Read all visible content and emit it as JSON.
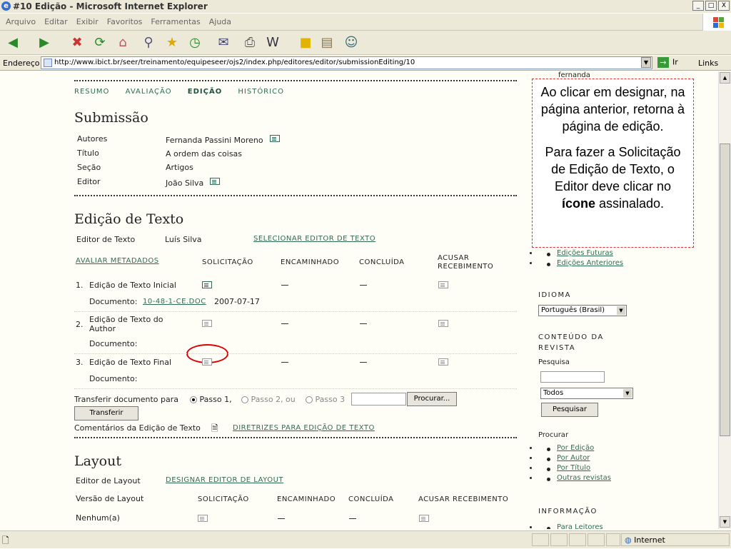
{
  "window": {
    "title": "#10 Edição - Microsoft Internet Explorer",
    "controls": [
      "_",
      "□",
      "X"
    ]
  },
  "menu": [
    "Arquivo",
    "Editar",
    "Exibir",
    "Favoritos",
    "Ferramentas",
    "Ajuda"
  ],
  "address": {
    "label": "Endereço",
    "url": "http://www.ibict.br/seer/treinamento/equipeseer/ojs2/index.php/editores/editor/submissionEditing/10",
    "go": "Ir",
    "links": "Links"
  },
  "status": {
    "zone": "Internet"
  },
  "tabs": [
    "RESUMO",
    "AVALIAÇÃO",
    "EDIÇÃO",
    "HISTÓRICO"
  ],
  "submission": {
    "heading": "Submissão",
    "rows": [
      {
        "label": "Autores",
        "value": "Fernanda Passini Moreno"
      },
      {
        "label": "Título",
        "value": "A ordem das coisas"
      },
      {
        "label": "Seção",
        "value": "Artigos"
      },
      {
        "label": "Editor",
        "value": "João Silva"
      }
    ]
  },
  "copyedit": {
    "heading": "Edição de Texto",
    "editor_label": "Editor de Texto",
    "editor_name": "Luís Silva",
    "select_link": "SELECIONAR EDITOR DE TEXTO",
    "metadata_link": "AVALIAR METADADOS",
    "columns": [
      "SOLICITAÇÃO",
      "ENCAMINHADO",
      "CONCLUÍDA",
      "ACUSAR RECEBIMENTO"
    ],
    "steps": [
      {
        "num": "1.",
        "name": "Edição de Texto Inicial",
        "doc_label": "Documento:",
        "doc_file": "10-48-1-CE.DOC",
        "doc_date": "2007-07-17"
      },
      {
        "num": "2.",
        "name": "Edição de Texto do Author",
        "doc_label": "Documento:"
      },
      {
        "num": "3.",
        "name": "Edição de Texto Final",
        "doc_label": "Documento:"
      }
    ],
    "transfer_label": "Transferir documento para",
    "radio1": "Passo 1,",
    "radio2": "Passo 2, ou",
    "radio3": "Passo 3",
    "browse_button": "Procurar...",
    "transfer_button": "Transferir",
    "comments_label": "Comentários da Edição de Texto",
    "guidelines_link": "DIRETRIZES PARA EDIÇÃO DE TEXTO"
  },
  "layout": {
    "heading": "Layout",
    "editor_label": "Editor de Layout",
    "designate_link": "DESIGNAR EDITOR DE LAYOUT",
    "version_label": "Versão de Layout",
    "columns": [
      "SOLICITAÇÃO",
      "ENCAMINHADO",
      "CONCLUÍDA",
      "ACUSAR RECEBIMENTO"
    ],
    "row_label": "Nenhum(a)"
  },
  "sidebar": {
    "top_partial": "fernanda",
    "issues": [
      "Edições Futuras",
      "Edições Anteriores"
    ],
    "language_title": "IDIOMA",
    "language_value": "Português (Brasil)",
    "content_title_1": "CONTEÚDO DA",
    "content_title_2": "REVISTA",
    "search_label": "Pesquisa",
    "search_scope": "Todos",
    "search_button": "Pesquisar",
    "browse_title": "Procurar",
    "browse_links": [
      "Por Edição",
      "Por Autor",
      "Por Título",
      "Outras revistas"
    ],
    "info_title": "INFORMAÇÃO",
    "info_partial": "Para Leitores"
  },
  "callout": {
    "p1": "Ao clicar em designar, na página anterior, retorna à página de edição.",
    "p2_pre": "Para fazer a Solicitação de Edição de Texto, o Editor deve clicar no ",
    "p2_bold": "ícone",
    "p2_post": " assinalado."
  }
}
